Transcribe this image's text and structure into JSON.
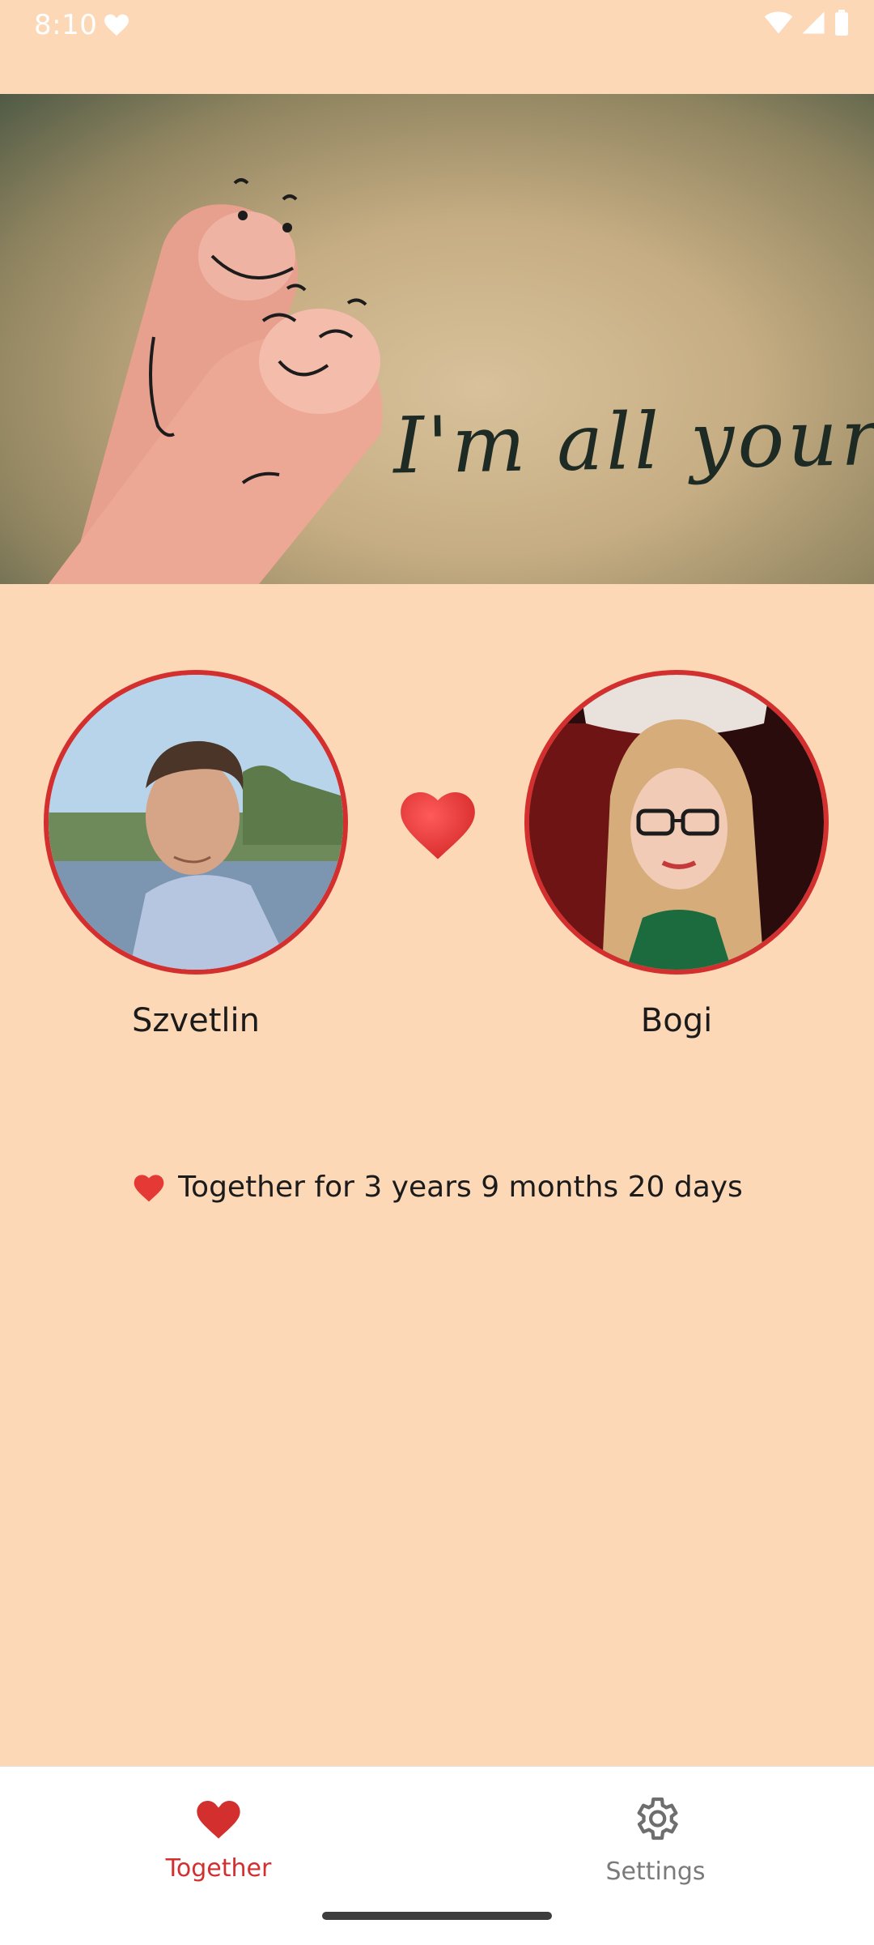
{
  "status_bar": {
    "time": "8:10"
  },
  "hero": {
    "caption": "I'm all yours♡"
  },
  "couple": {
    "partner_left": {
      "name": "Szvetlin"
    },
    "partner_right": {
      "name": "Bogi"
    }
  },
  "together": {
    "text": "Together for 3 years 9 months 20 days"
  },
  "bottom_nav": {
    "items": [
      {
        "label": "Together",
        "icon": "heart-icon",
        "active": true
      },
      {
        "label": "Settings",
        "icon": "gear-icon",
        "active": false
      }
    ]
  },
  "colors": {
    "background": "#FCD8B6",
    "accent": "#D32F2F",
    "nav_background": "#FFFFFF",
    "inactive": "#7A7A7A"
  }
}
